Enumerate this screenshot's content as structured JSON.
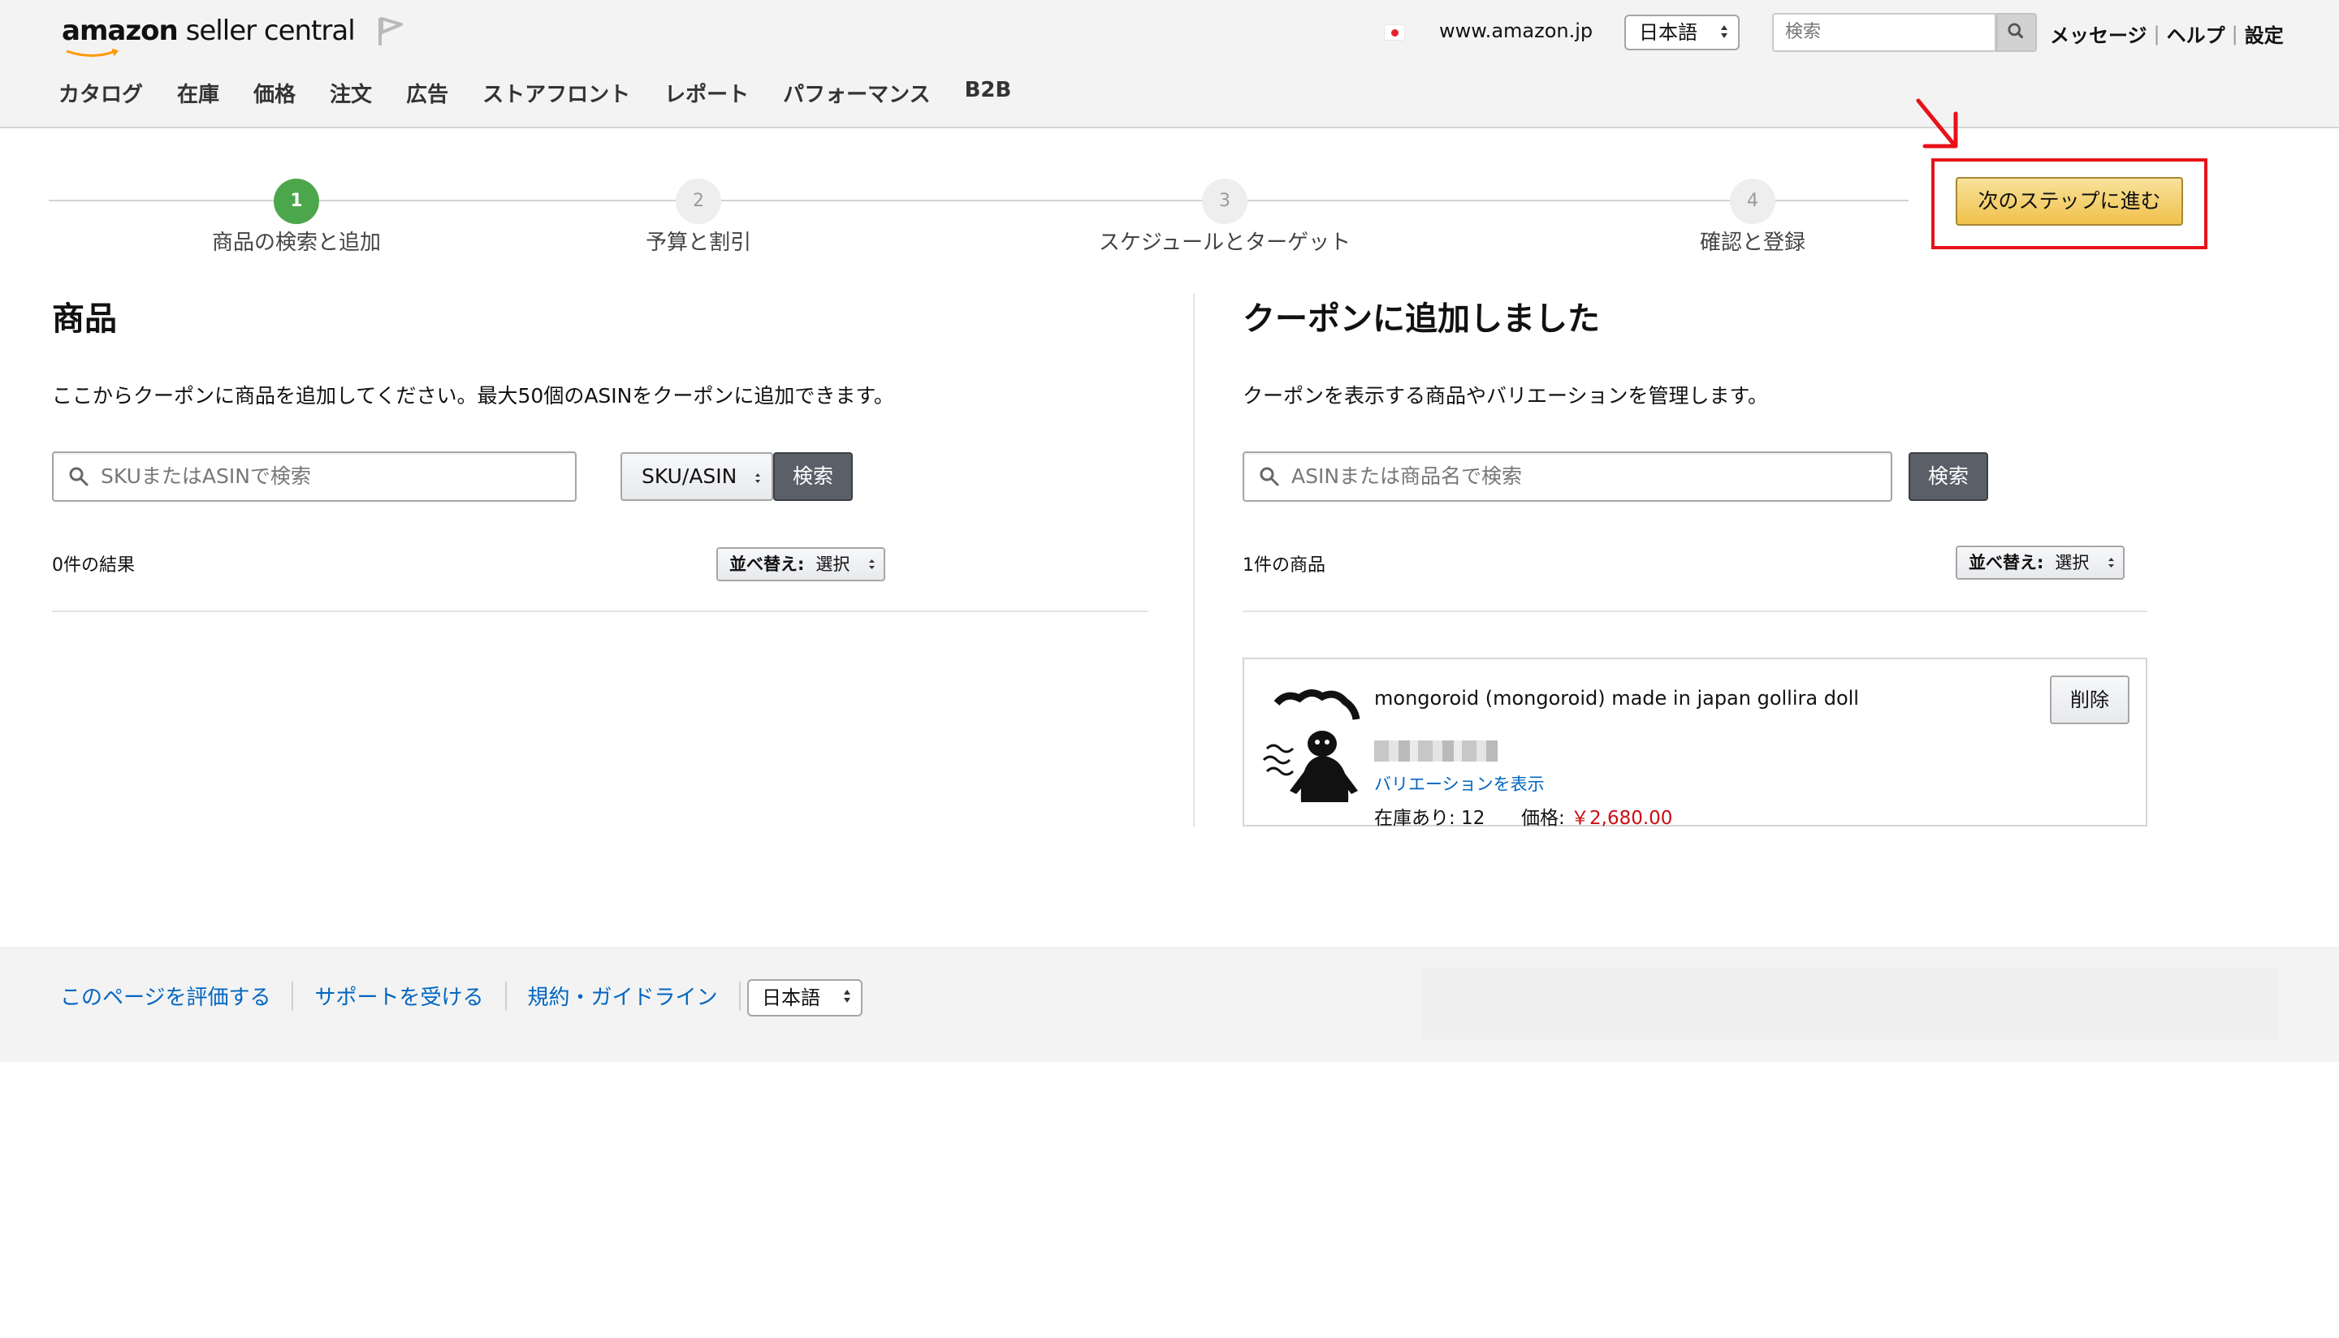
{
  "header": {
    "logo_brand": "amazon",
    "logo_rest": "seller central",
    "marketplace": "www.amazon.jp",
    "language": "日本語",
    "search_placeholder": "検索",
    "links": [
      "メッセージ",
      "ヘルプ",
      "設定"
    ]
  },
  "nav": [
    "カタログ",
    "在庫",
    "価格",
    "注文",
    "広告",
    "ストアフロント",
    "レポート",
    "パフォーマンス",
    "B2B"
  ],
  "steps": [
    {
      "number": "1",
      "label": "商品の検索と追加"
    },
    {
      "number": "2",
      "label": "予算と割引"
    },
    {
      "number": "3",
      "label": "スケジュールとターゲット"
    },
    {
      "number": "4",
      "label": "確認と登録"
    }
  ],
  "next_button": "次のステップに進む",
  "left": {
    "title": "商品",
    "description": "ここからクーポンに商品を追加してください。最大50個のASINをクーポンに追加できます。",
    "search_placeholder": "SKUまたはASINで検索",
    "type_select": "SKU/ASIN",
    "search_button": "検索",
    "result_count": "0件の結果",
    "sort_label": "並べ替え:",
    "sort_value": "選択"
  },
  "right": {
    "title": "クーポンに追加しました",
    "description": "クーポンを表示する商品やバリエーションを管理します。",
    "search_placeholder": "ASINまたは商品名で検索",
    "search_button": "検索",
    "result_count": "1件の商品",
    "sort_label": "並べ替え:",
    "sort_value": "選択",
    "product": {
      "title": "mongoroid (mongoroid) made in japan gollira doll",
      "variation_link": "バリエーションを表示",
      "stock_label": "在庫あり: 12",
      "price_label": "価格:",
      "price": "￥2,680.00",
      "delete_button": "削除"
    }
  },
  "footer": {
    "links": [
      "このページを評価する",
      "サポートを受ける",
      "規約・ガイドライン"
    ],
    "language": "日本語"
  },
  "colors": {
    "active_step": "#4ca64c",
    "primary_button": "#f0c14b",
    "highlight": "#e8121a",
    "link": "#0066c0",
    "price": "#cc0c12"
  }
}
